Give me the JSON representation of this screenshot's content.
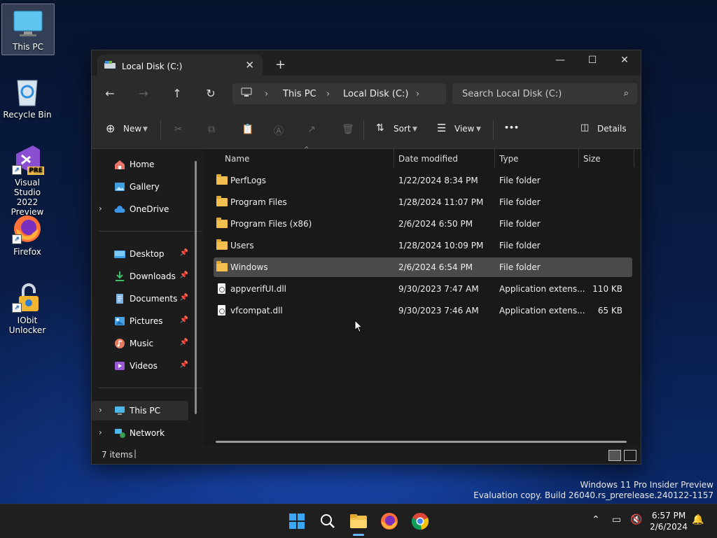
{
  "desktop": {
    "icons": [
      {
        "label": "This PC"
      },
      {
        "label": "Recycle Bin"
      },
      {
        "label_line1": "Visual Studio",
        "label_line2": "2022 Preview",
        "badge": "PRE"
      },
      {
        "label": "Firefox"
      },
      {
        "label_line1": "IObit",
        "label_line2": "Unlocker"
      }
    ]
  },
  "window": {
    "tab_title": "Local Disk (C:)",
    "new_tab": "+",
    "controls": {
      "minimize": "—",
      "maximize": "☐",
      "close": "✕"
    },
    "address": {
      "segments": [
        "This PC",
        "Local Disk (C:)"
      ]
    },
    "search_placeholder": "Search Local Disk (C:)",
    "toolbar": {
      "new": "New",
      "sort": "Sort",
      "view": "View",
      "more": "•••",
      "details": "Details"
    },
    "nav": {
      "top": [
        "Home",
        "Gallery",
        "OneDrive"
      ],
      "quick": [
        "Desktop",
        "Downloads",
        "Documents",
        "Pictures",
        "Music",
        "Videos"
      ],
      "bottom": [
        "This PC",
        "Network"
      ]
    },
    "columns": {
      "name": "Name",
      "date": "Date modified",
      "type": "Type",
      "size": "Size"
    },
    "files": [
      {
        "name": "PerfLogs",
        "date": "1/22/2024 8:34 PM",
        "type": "File folder",
        "size": "",
        "kind": "folder"
      },
      {
        "name": "Program Files",
        "date": "1/28/2024 11:07 PM",
        "type": "File folder",
        "size": "",
        "kind": "folder"
      },
      {
        "name": "Program Files (x86)",
        "date": "2/6/2024 6:50 PM",
        "type": "File folder",
        "size": "",
        "kind": "folder"
      },
      {
        "name": "Users",
        "date": "1/28/2024 10:09 PM",
        "type": "File folder",
        "size": "",
        "kind": "folder"
      },
      {
        "name": "Windows",
        "date": "2/6/2024 6:54 PM",
        "type": "File folder",
        "size": "",
        "kind": "folder"
      },
      {
        "name": "appverifUI.dll",
        "date": "9/30/2023 7:47 AM",
        "type": "Application extens...",
        "size": "110 KB",
        "kind": "dll"
      },
      {
        "name": "vfcompat.dll",
        "date": "9/30/2023 7:46 AM",
        "type": "Application extens...",
        "size": "65 KB",
        "kind": "dll"
      }
    ],
    "status": "7 items"
  },
  "watermark": {
    "line1": "Windows 11 Pro Insider Preview",
    "line2": "Evaluation copy. Build 26040.rs_prerelease.240122-1157"
  },
  "taskbar": {
    "time": "6:57 PM",
    "date": "2/6/2024"
  },
  "colors": {
    "folder": "#f3c04f",
    "accent": "#0078d4",
    "window_bg": "#1c1c1c"
  }
}
